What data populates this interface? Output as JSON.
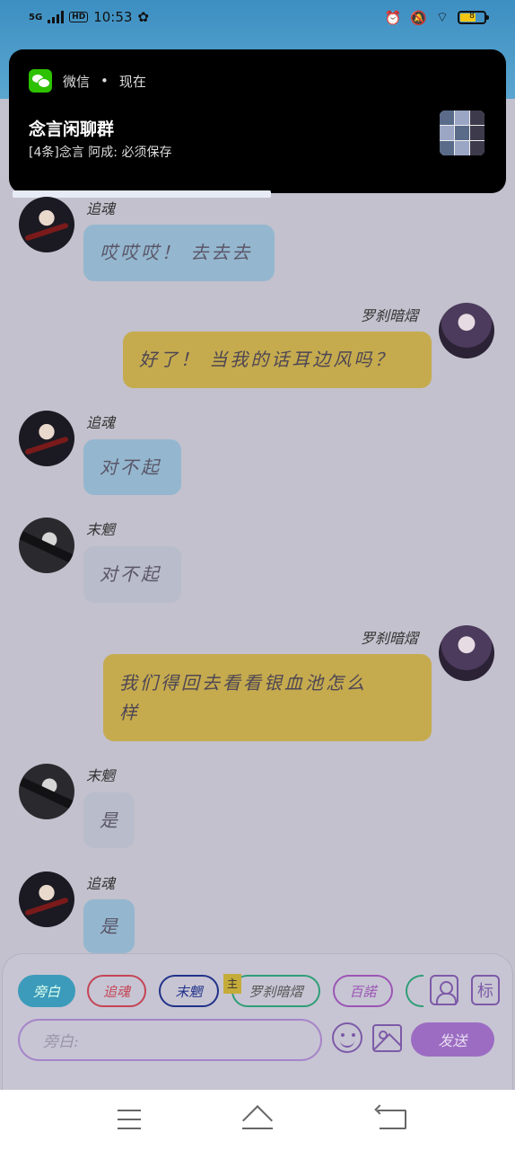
{
  "status_bar": {
    "network": "5G",
    "hd": "HD",
    "time": "10:53",
    "battery_level": "8"
  },
  "notification": {
    "app_name": "微信",
    "separator": "•",
    "when": "现在",
    "title": "念言闲聊群",
    "body": "[4条]念言 阿成: 必须保存"
  },
  "messages": [
    {
      "sender": "追魂",
      "text": "哎哎哎！ 去去去"
    },
    {
      "sender": "罗刹暗熠",
      "text": "好了！ 当我的话耳边风吗？"
    },
    {
      "sender": "追魂",
      "text": "对不起"
    },
    {
      "sender": "末魍",
      "text": "对不起"
    },
    {
      "sender": "罗刹暗熠",
      "text_line1": "我们得回去看看银血池怎么",
      "text_line2": "样"
    },
    {
      "sender": "末魍",
      "text": "是"
    },
    {
      "sender": "追魂",
      "text": "是"
    }
  ],
  "role_chips": [
    "旁白",
    "追魂",
    "末魍",
    "罗刹暗熠",
    "百諾"
  ],
  "main_badge": "主",
  "biao_label": "标",
  "input": {
    "placeholder": "旁白:"
  },
  "send_label": "发送"
}
